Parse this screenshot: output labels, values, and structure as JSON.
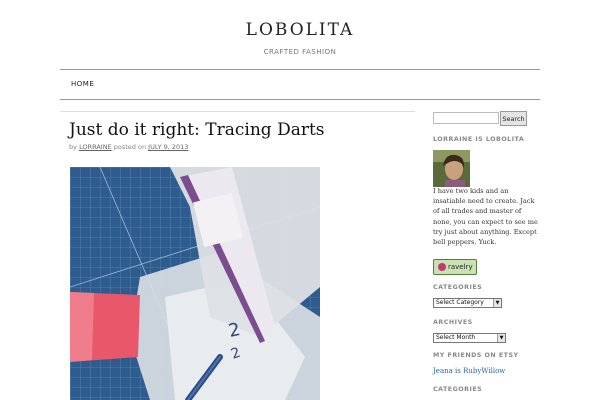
{
  "site": {
    "title": "LOBOLITA",
    "tagline": "CRAFTED FASHION"
  },
  "nav": {
    "items": [
      {
        "label": "HOME"
      }
    ]
  },
  "post": {
    "title": "Just do it right: Tracing Darts",
    "meta_by": "by",
    "author": "LORRAINE",
    "meta_posted": "posted on",
    "date": "JULY 9, 2013"
  },
  "sidebar": {
    "search": {
      "value": "",
      "button_label": "Search"
    },
    "about": {
      "title": "LORRAINE IS LOBOLITA",
      "bio": "I have two kids and an insatiable need to create. Jack of all trades and master of none, you can expect to see me try just about anything. Except bell peppers. Yuck."
    },
    "ravelry_badge": {
      "label": "ravelry"
    },
    "categories": {
      "title": "CATEGORIES",
      "selected": "Select Category"
    },
    "archives": {
      "title": "ARCHIVES",
      "selected": "Select Month"
    },
    "friends": {
      "title": "MY FRIENDS ON ETSY",
      "link": "Jeana is RubyWillow"
    },
    "categories2": {
      "title": "CATEGORIES"
    }
  },
  "colors": {
    "link": "#2d6aa5",
    "cutting_mat": "#2f5c8f",
    "tracing_pink": "#e8576a",
    "heading_gray": "#888888"
  }
}
